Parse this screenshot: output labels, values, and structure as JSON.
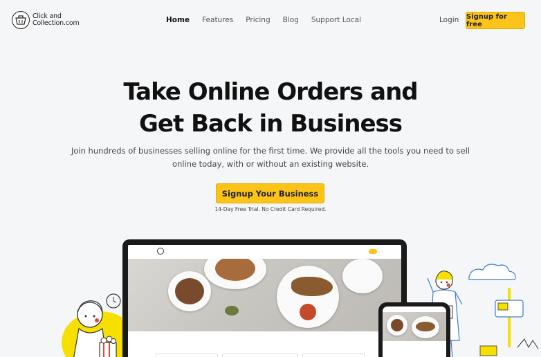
{
  "brand": {
    "line1": "Click and",
    "line2": "Collection.com"
  },
  "nav": {
    "links": [
      "Home",
      "Features",
      "Pricing",
      "Blog",
      "Support Local"
    ],
    "login": "Login",
    "signup": "Signup for free"
  },
  "hero": {
    "title_line1": "Take Online Orders and",
    "title_line2": "Get Back in Business",
    "subtitle": "Join hundreds of businesses selling online for the first time. We provide all the tools you need to sell online today, with or without an existing website.",
    "cta": "Signup Your Business",
    "cta_note": "14-Day Free Trial. No Credit Card Required."
  },
  "colors": {
    "accent": "#fcc419",
    "background": "#f5f6f8",
    "text": "#111111"
  }
}
